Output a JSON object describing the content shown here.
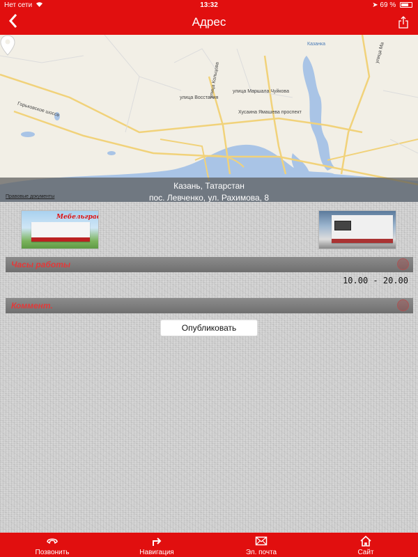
{
  "status_bar": {
    "carrier": "Нет сети",
    "time": "13:32",
    "battery": "69 %"
  },
  "nav": {
    "title": "Адрес"
  },
  "map": {
    "labels": {
      "gorkovskoe": "Горьковское шоссе",
      "vosstaniya": "улица Восстания",
      "chuykova": "улица Маршала Чуйкова",
      "yamasheva": "Хусаина Ямашева проспект",
      "kazanka": "Казанка",
      "koltsova": "улица Кольцова",
      "mav": "улица Ма"
    },
    "legal": "Правовые документы",
    "address_line1": "Казань, Татарстан",
    "address_line2": "пос. Левченко, ул. Рахимова, 8"
  },
  "photos": {
    "photo1_sign": "Мебельград"
  },
  "hours": {
    "title": "Часы работы",
    "value": "10.00 - 20.00"
  },
  "comment": {
    "title": "Коммент."
  },
  "publish_label": "Опубликовать",
  "tabs": [
    {
      "label": "Позвонить",
      "icon": "phone-icon"
    },
    {
      "label": "Навигация",
      "icon": "navigation-arrow-icon"
    },
    {
      "label": "Эл. почта",
      "icon": "mail-icon"
    },
    {
      "label": "Сайт",
      "icon": "home-icon"
    }
  ],
  "colors": {
    "accent": "#e10f0f",
    "section_text": "#e23a3a"
  }
}
